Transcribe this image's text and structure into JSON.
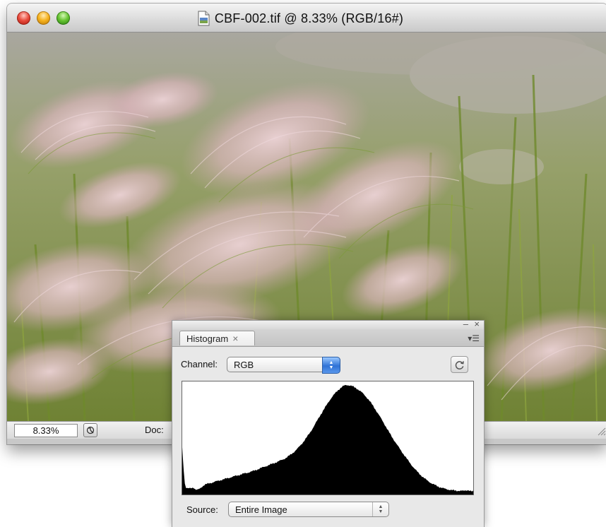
{
  "window": {
    "title": "CBF-002.tif @ 8.33% (RGB/16#)",
    "title_icon": "tiff-document-icon",
    "controls": [
      "close",
      "minimize",
      "zoom"
    ]
  },
  "canvas": {
    "content": "photo"
  },
  "statusbar": {
    "zoom": "8.33%",
    "doc_label": "Doc:"
  },
  "histogram_panel": {
    "tab_label": "Histogram",
    "tab_close": "×",
    "min_glyph": "–",
    "close_glyph": "×",
    "menu_glyph": "▾☰",
    "channel_label": "Channel:",
    "channel_value": "RGB",
    "source_label": "Source:",
    "source_value": "Entire Image",
    "colors": {
      "histogram_fill": "#000000",
      "select_accent": "#2f72d6"
    }
  },
  "chart_data": {
    "type": "area",
    "title": "",
    "xlabel": "",
    "ylabel": "",
    "x": [
      0,
      4,
      8,
      12,
      16,
      20,
      24,
      28,
      32,
      36,
      40,
      44,
      48,
      52,
      56,
      60,
      64,
      68,
      72,
      76,
      80,
      84,
      88,
      92,
      96,
      100
    ],
    "values": [
      0.42,
      0.05,
      0.08,
      0.11,
      0.14,
      0.17,
      0.2,
      0.24,
      0.28,
      0.33,
      0.42,
      0.56,
      0.74,
      0.9,
      0.99,
      0.96,
      0.86,
      0.7,
      0.52,
      0.36,
      0.22,
      0.12,
      0.06,
      0.03,
      0.02,
      0.02
    ],
    "xlim": [
      0,
      100
    ],
    "ylim": [
      0,
      1
    ],
    "grid": false
  }
}
